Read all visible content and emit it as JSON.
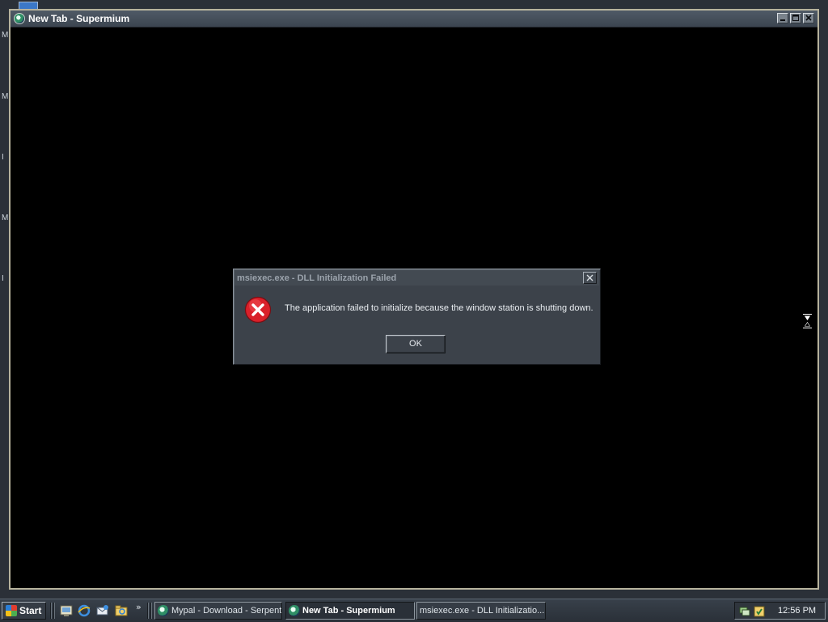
{
  "desktop": {
    "side_labels": [
      "M",
      "M",
      "I",
      "M",
      "I"
    ]
  },
  "browser": {
    "title": "New Tab - Supermium",
    "controls": {
      "minimize": "_",
      "maximize": "□",
      "close": "✕"
    }
  },
  "dialog": {
    "title": "msiexec.exe - DLL Initialization Failed",
    "message": "The application failed to initialize because the window station is shutting down.",
    "ok_label": "OK",
    "icon": "error-icon"
  },
  "taskbar": {
    "start_label": "Start",
    "quick_launch": [
      "show-desktop-icon",
      "internet-explorer-icon",
      "outlook-express-icon",
      "explorer-icon"
    ],
    "more_label": "»",
    "tasks": [
      {
        "label": "Mypal - Download - Serpent",
        "active": false
      },
      {
        "label": "New Tab - Supermium",
        "active": true
      },
      {
        "label": "msiexec.exe - DLL Initializatio...",
        "active": false
      }
    ],
    "clock": "12:56 PM"
  },
  "colors": {
    "desktop": "#2b3038",
    "window_border": "#b7b39d",
    "dialog_bg": "#3c424a",
    "error_red": "#d9202a"
  }
}
